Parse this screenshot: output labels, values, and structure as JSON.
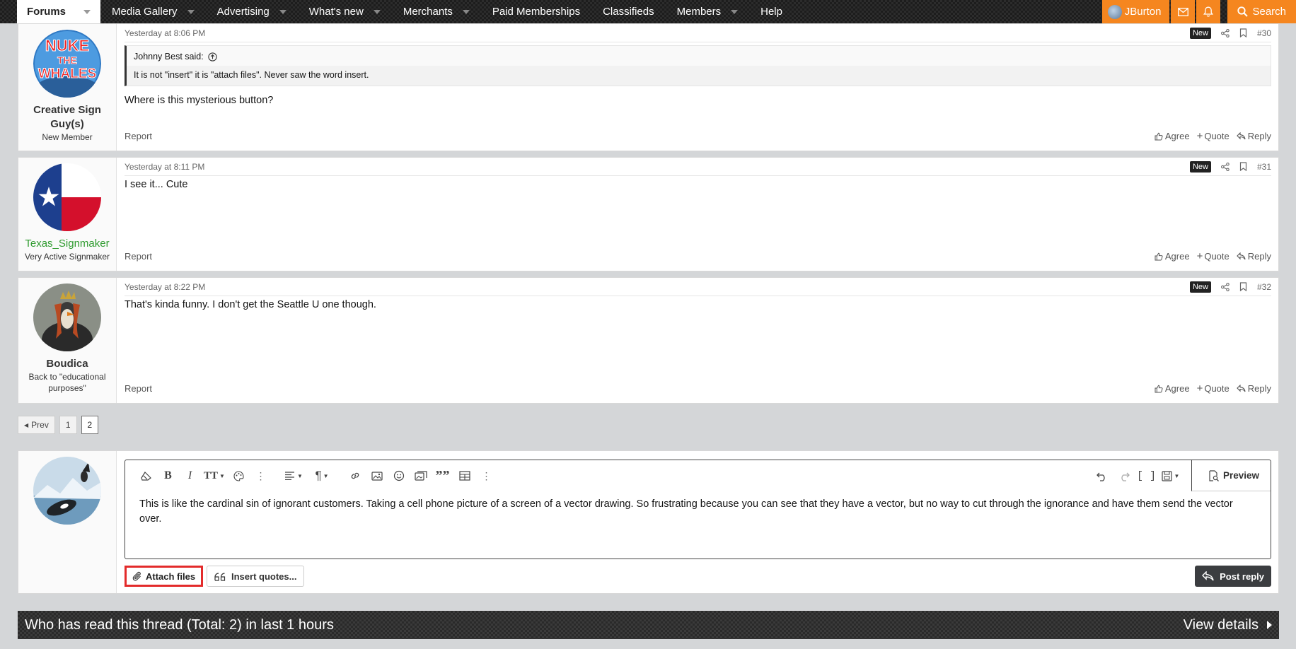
{
  "nav": {
    "tabs": [
      {
        "label": "Forums"
      },
      {
        "label": "Media Gallery"
      },
      {
        "label": "Advertising"
      },
      {
        "label": "What's new"
      },
      {
        "label": "Merchants"
      },
      {
        "label": "Paid Memberships"
      },
      {
        "label": "Classifieds"
      },
      {
        "label": "Members"
      },
      {
        "label": "Help"
      }
    ],
    "username": "JBurton",
    "search_label": "Search",
    "accent_color": "#f5861f"
  },
  "posts": [
    {
      "author": "Creative Sign Guy(s)",
      "user_title": "New Member",
      "avatar_icon": "nuke-the-whales-logo",
      "avatar_lines": [
        "NUKE",
        "THE",
        "WHALES"
      ],
      "date": "Yesterday at 8:06 PM",
      "badge": "New",
      "number": "#30",
      "quote_author": "Johnny Best said:",
      "quote_text": "It is not \"insert\" it is \"attach files\". Never saw the word insert.",
      "message": "Where is this mysterious button?"
    },
    {
      "author": "Texas_Signmaker",
      "user_title": "Very Active Signmaker",
      "avatar_icon": "texas-flag-avatar",
      "date": "Yesterday at 8:11 PM",
      "badge": "New",
      "number": "#31",
      "message": "I see it... Cute"
    },
    {
      "author": "Boudica",
      "user_title": "Back to \"educational purposes\"",
      "avatar_icon": "penguin-queen-avatar",
      "date": "Yesterday at 8:22 PM",
      "badge": "New",
      "number": "#32",
      "message": "That's kinda funny. I don't get the Seattle U one though."
    }
  ],
  "post_actions": {
    "report": "Report",
    "agree": "Agree",
    "quote": "Quote",
    "reply": "Reply"
  },
  "pagination": {
    "prev": "Prev",
    "pages": [
      "1",
      "2"
    ],
    "current": "2"
  },
  "editor": {
    "text": "This is like the cardinal sin of ignorant customers. Taking a cell phone picture of a screen of a vector drawing. So frustrating because you can see that they have a vector, but no way to cut through the ignorance and have them send the vector over.",
    "preview_label": "Preview",
    "attach_label": "Attach files",
    "insert_quotes_label": "Insert quotes...",
    "post_reply_label": "Post reply"
  },
  "who_read": {
    "title": "Who has read this thread (Total: 2) in last 1 hours",
    "view_details": "View details"
  }
}
